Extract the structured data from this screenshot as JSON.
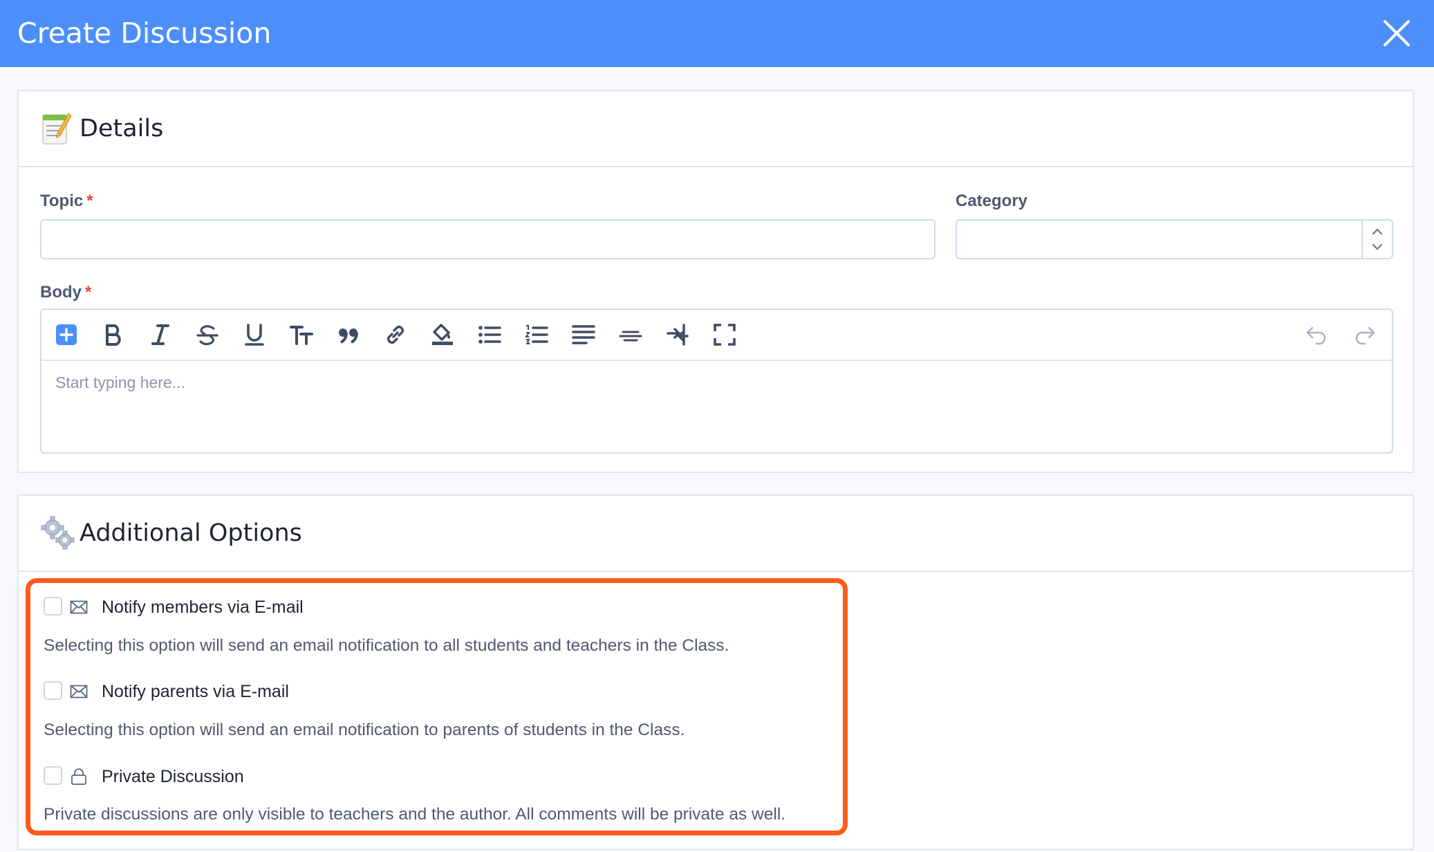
{
  "window": {
    "title": "Create Discussion"
  },
  "details": {
    "heading": "Details",
    "topic_label": "Topic",
    "topic_value": "",
    "category_label": "Category",
    "category_value": "",
    "body_label": "Body",
    "required_mark": "*",
    "body_placeholder": "Start typing here..."
  },
  "toolbar": {
    "buttons": [
      "add-block",
      "bold",
      "italic",
      "strikethrough",
      "underline",
      "font-size",
      "blockquote",
      "link",
      "highlight",
      "bullet-list",
      "numbered-list",
      "align-left",
      "align-center",
      "indent",
      "fullscreen"
    ],
    "history": [
      "undo",
      "redo"
    ]
  },
  "additional": {
    "heading": "Additional Options",
    "options": [
      {
        "label": "Notify members via E-mail",
        "icon": "envelope-icon",
        "checked": false,
        "description": "Selecting this option will send an email notification to all students and teachers in the Class."
      },
      {
        "label": "Notify parents via E-mail",
        "icon": "envelope-icon",
        "checked": false,
        "description": "Selecting this option will send an email notification to parents of students in the Class."
      },
      {
        "label": "Private Discussion",
        "icon": "lock-icon",
        "checked": false,
        "description": "Private discussions are only visible to teachers and the author. All comments will be private as well."
      }
    ]
  },
  "colors": {
    "header": "#4c8ffa",
    "highlight_border": "#ff5a1a",
    "required": "#e5443b",
    "toolbar_accent": "#4c8ffa"
  }
}
